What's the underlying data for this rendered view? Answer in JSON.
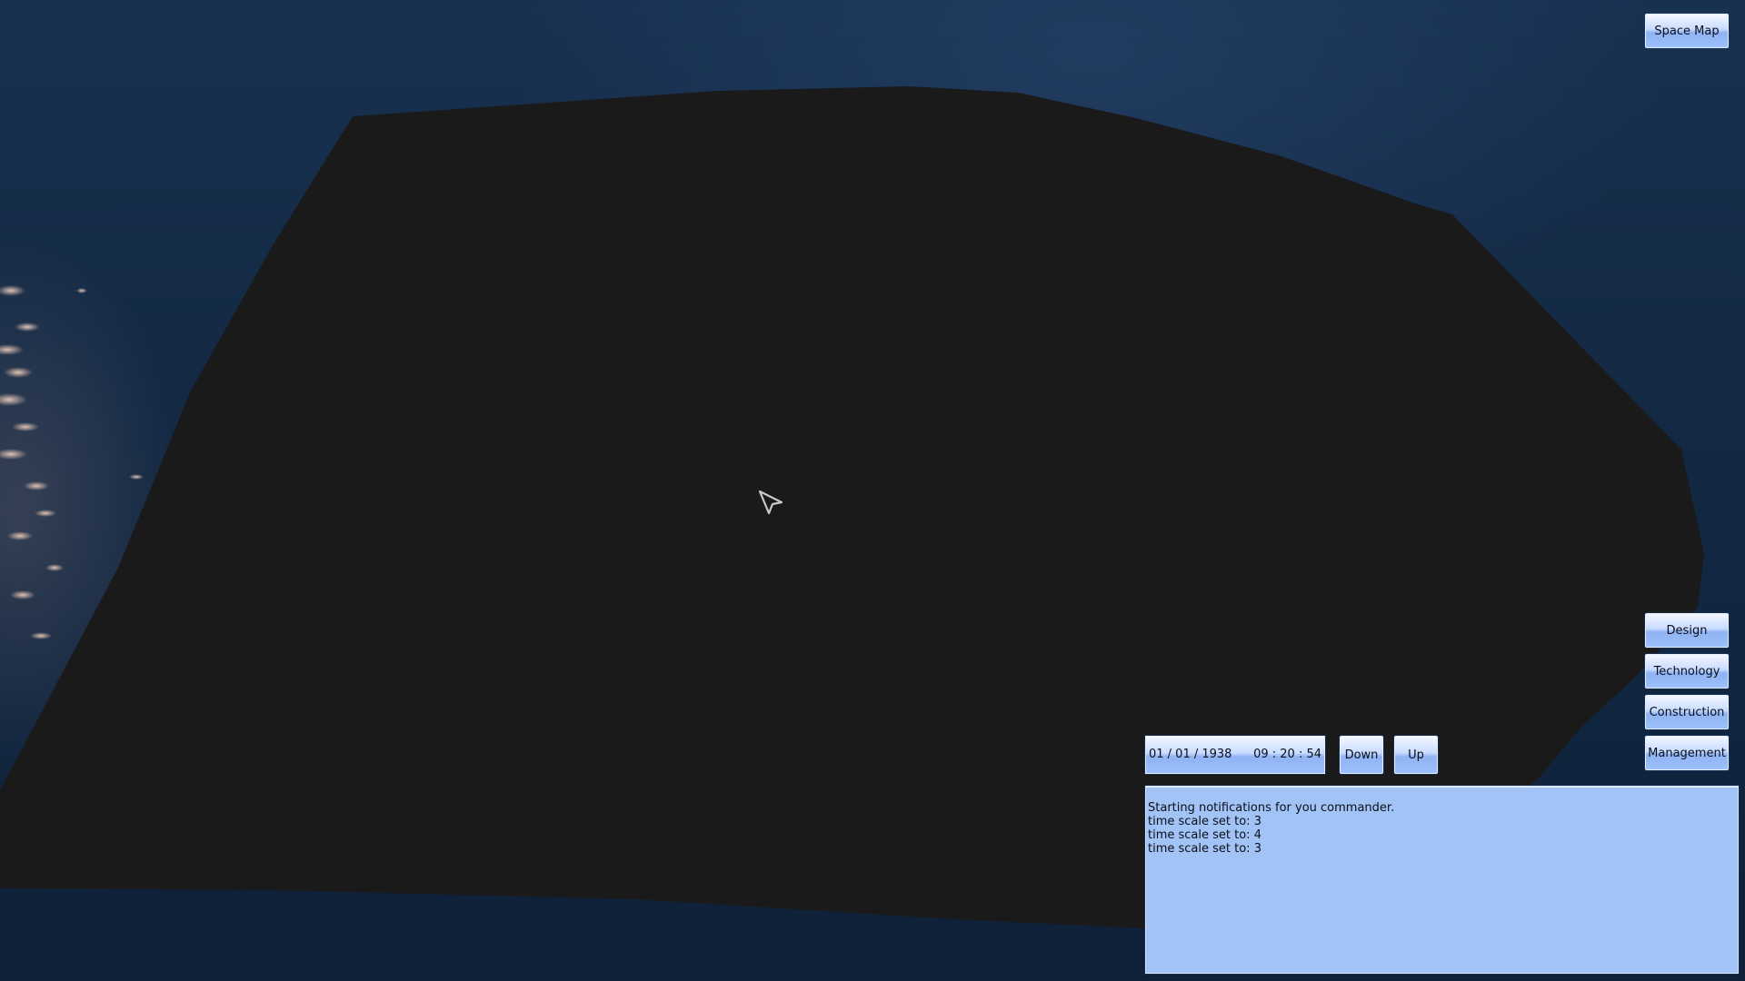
{
  "top_right": {
    "space_map_label": "Space Map"
  },
  "side_menu": {
    "design_label": "Design",
    "technology_label": "Technology",
    "construction_label": "Construction",
    "management_label": "Management"
  },
  "time_panel": {
    "date": "01 / 01 / 1938",
    "time": "09 : 20 : 54",
    "down_label": "Down",
    "up_label": "Up"
  },
  "notifications": {
    "lines": [
      "Starting notifications for you commander.",
      "time scale set to: 3",
      "time scale set to: 4",
      "time scale set to: 3"
    ]
  },
  "icons": {
    "cursor": "mouse-pointer-icon"
  }
}
